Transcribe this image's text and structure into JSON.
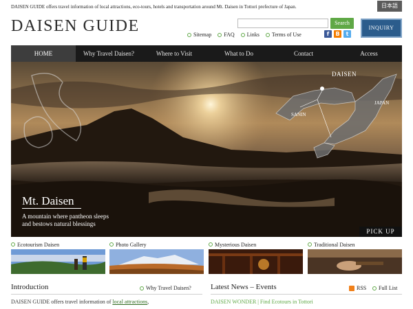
{
  "header": {
    "tagline": "DAISEN GUIDE offers travel information of local attractions, eco-tours, hotels and transportation around Mt. Daisen in Tottori prefecture of Japan.",
    "language_button": "日本語",
    "logo": "DAISEN GUIDE",
    "search_placeholder": "",
    "search_button": "Search",
    "inquiry_button": "INQUIRY",
    "util_links": [
      "Sitemap",
      "FAQ",
      "Links",
      "Terms of Use"
    ],
    "social_icons": [
      "facebook-icon",
      "blog-icon",
      "twitter-icon"
    ]
  },
  "nav": [
    "HOME",
    "Why Travel Daisen?",
    "Where to Visit",
    "What to Do",
    "Contact",
    "Access"
  ],
  "hero": {
    "title": "Mt. Daisen",
    "subtitle_line1": "A mountain where pantheon sleeps",
    "subtitle_line2": "and bestows natural blessings",
    "map_label_daisen": "DAISEN",
    "map_label_japan": "JAPAN",
    "map_label_sanin": "SANIN",
    "pickup": "PICK UP"
  },
  "thumbs": [
    {
      "label": "Ecotourism Daisen"
    },
    {
      "label": "Photo Gallery"
    },
    {
      "label": "Mysterious Daisen"
    },
    {
      "label": "Traditional Daisen"
    }
  ],
  "intro": {
    "title": "Introduction",
    "link": "Why Travel Daisen?",
    "text_prefix": "DAISEN GUIDE offers travel information of ",
    "text_link": "local attractions",
    "text_suffix": ","
  },
  "news": {
    "title": "Latest News – Events",
    "rss": "RSS",
    "full_list": "Full List",
    "first_item": "DAISEN WONDER | Find Ecotours in Tottori"
  },
  "colors": {
    "accent_green": "#5fa846",
    "nav_bg": "#1a1a1a",
    "inquiry_blue": "#2b5c8c"
  }
}
